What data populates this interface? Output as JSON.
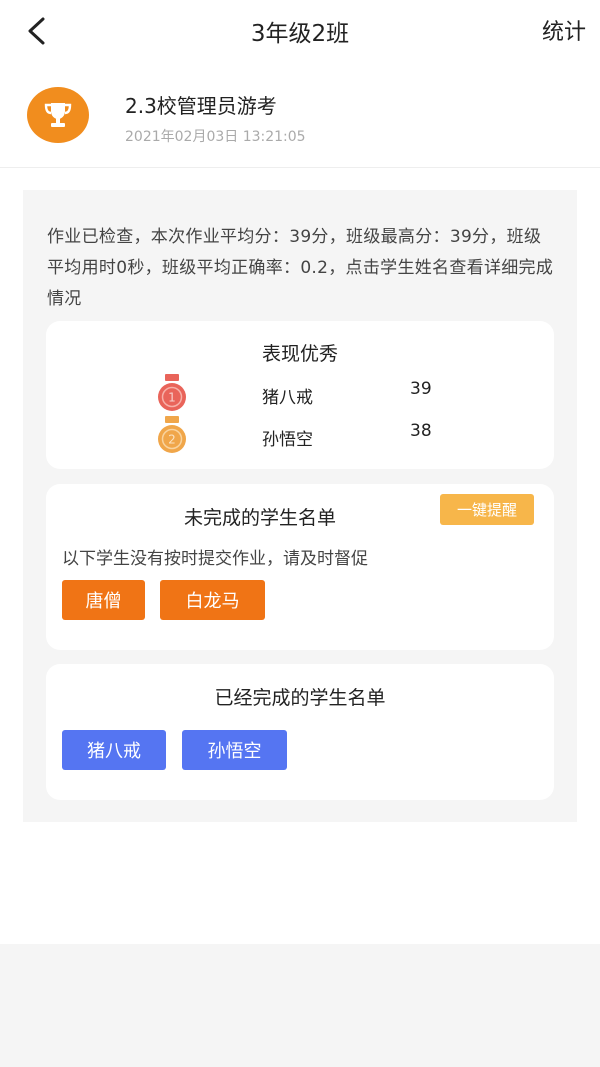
{
  "nav": {
    "title": "3年级2班",
    "stats_label": "统计"
  },
  "homework": {
    "title": "2.3校管理员游考",
    "time": "2021年02月03日 13:21:05"
  },
  "summary": "作业已检查，本次作业平均分：39分，班级最高分：39分，班级平均用时0秒，班级平均正确率：0.2，点击学生姓名查看详细完成情况",
  "excellent": {
    "title": "表现优秀",
    "rows": [
      {
        "rank": "1",
        "name": "猪八戒",
        "score": "39"
      },
      {
        "rank": "2",
        "name": "孙悟空",
        "score": "38"
      }
    ]
  },
  "incomplete": {
    "title": "未完成的学生名单",
    "remind_label": "一键提醒",
    "hint": "以下学生没有按时提交作业，请及时督促",
    "students": [
      "唐僧",
      "白龙马"
    ]
  },
  "complete": {
    "title": "已经完成的学生名单",
    "students": [
      "猪八戒",
      "孙悟空"
    ]
  },
  "colors": {
    "orange": "#f07415",
    "blue": "#5575f2",
    "remind": "#f7b64a",
    "trophy": "#f18d1e",
    "gold_medal": "#e9645a",
    "silver_medal": "#f0a64a"
  },
  "icons": [
    "back-arrow-icon",
    "trophy-icon",
    "medal-1-icon",
    "medal-2-icon"
  ]
}
